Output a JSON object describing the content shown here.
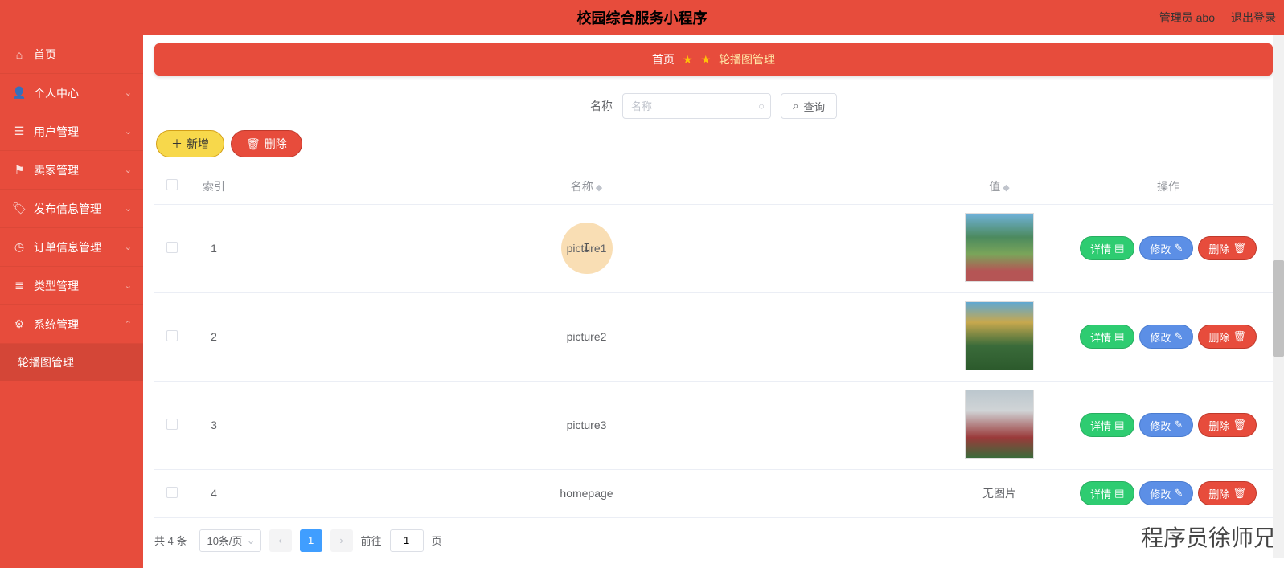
{
  "header": {
    "title": "校园综合服务小程序",
    "admin_label": "管理员 abo",
    "logout_label": "退出登录"
  },
  "sidebar": {
    "items": [
      {
        "label": "首页",
        "icon": "home",
        "expandable": false,
        "name": "sidebar-item-home"
      },
      {
        "label": "个人中心",
        "icon": "user",
        "expandable": true,
        "name": "sidebar-item-profile"
      },
      {
        "label": "用户管理",
        "icon": "users",
        "expandable": true,
        "name": "sidebar-item-user-mgmt"
      },
      {
        "label": "卖家管理",
        "icon": "flag",
        "expandable": true,
        "name": "sidebar-item-seller-mgmt"
      },
      {
        "label": "发布信息管理",
        "icon": "tags",
        "expandable": true,
        "name": "sidebar-item-publish-mgmt"
      },
      {
        "label": "订单信息管理",
        "icon": "clock",
        "expandable": true,
        "name": "sidebar-item-order-mgmt"
      },
      {
        "label": "类型管理",
        "icon": "list",
        "expandable": true,
        "name": "sidebar-item-type-mgmt"
      },
      {
        "label": "系统管理",
        "icon": "sliders",
        "expandable": true,
        "expanded": true,
        "name": "sidebar-item-system-mgmt"
      }
    ],
    "sub": {
      "label": "轮播图管理",
      "name": "sidebar-sub-carousel"
    }
  },
  "breadcrumb": {
    "home": "首页",
    "current": "轮播图管理"
  },
  "search": {
    "label": "名称",
    "placeholder": "名称",
    "button": "查询"
  },
  "actions": {
    "add": "新增",
    "delete": "删除"
  },
  "table": {
    "headers": {
      "index": "索引",
      "name": "名称",
      "value": "值",
      "ops": "操作"
    },
    "ops": {
      "detail": "详情",
      "edit": "修改",
      "delete": "删除"
    },
    "rows": [
      {
        "index": "1",
        "name": "picture1",
        "has_img": true,
        "thumb_class": "t1",
        "highlighted": true
      },
      {
        "index": "2",
        "name": "picture2",
        "has_img": true,
        "thumb_class": "t2"
      },
      {
        "index": "3",
        "name": "picture3",
        "has_img": true,
        "thumb_class": "t3"
      },
      {
        "index": "4",
        "name": "homepage",
        "has_img": false
      }
    ],
    "no_img_text": "无图片"
  },
  "pager": {
    "total": "共 4 条",
    "per_page": "10条/页",
    "current": "1",
    "goto_prefix": "前往",
    "goto_value": "1",
    "goto_suffix": "页"
  },
  "watermark": "程序员徐师兄"
}
